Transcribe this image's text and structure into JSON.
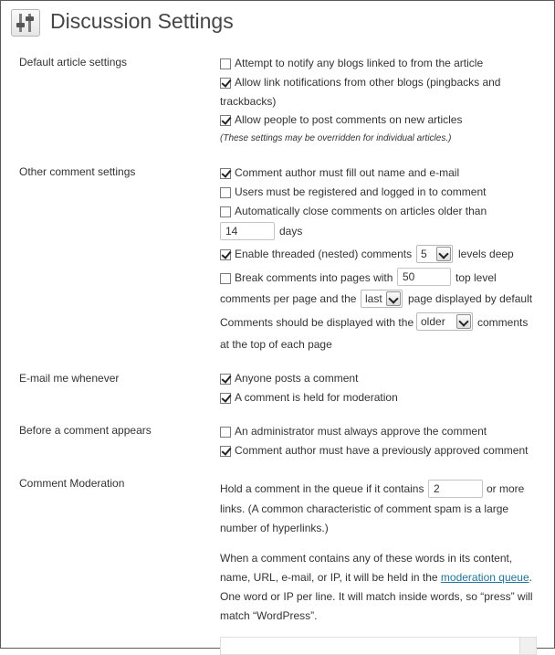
{
  "page": {
    "title": "Discussion Settings",
    "icon": "settings-sliders-icon"
  },
  "default_article": {
    "label": "Default article settings",
    "notify_blogs": {
      "label": "Attempt to notify any blogs linked to from the article",
      "checked": false
    },
    "allow_pingbacks": {
      "label_line1": "Allow link notifications from other blogs (pingbacks and",
      "label_line2": "trackbacks)",
      "checked": true
    },
    "allow_comments": {
      "label": "Allow people to post comments on new articles",
      "checked": true
    },
    "note": "(These settings may be overridden for individual articles.)"
  },
  "other_comment": {
    "label": "Other comment settings",
    "require_name_email": {
      "label": "Comment author must fill out name and e-mail",
      "checked": true
    },
    "registered_only": {
      "label": "Users must be registered and logged in to comment",
      "checked": false
    },
    "auto_close": {
      "label": "Automatically close comments on articles older than",
      "checked": false,
      "days_value": "14",
      "days_suffix": "days"
    },
    "threaded": {
      "label": "Enable threaded (nested) comments",
      "checked": true,
      "depth_value": "5",
      "suffix": "levels deep"
    },
    "paging": {
      "label": "Break comments into pages with",
      "checked": false,
      "per_page_value": "50",
      "suffix": "top level",
      "line2_prefix": "comments per page and the",
      "page_value": "last",
      "line2_suffix": "page displayed by default"
    },
    "order": {
      "prefix": "Comments should be displayed with the",
      "value": "older",
      "suffix": "comments",
      "line2": "at the top of each page"
    }
  },
  "email_me": {
    "label": "E-mail me whenever",
    "anyone_posts": {
      "label": "Anyone posts a comment",
      "checked": true
    },
    "held_for_moderation": {
      "label": "A comment is held for moderation",
      "checked": true
    }
  },
  "before_appears": {
    "label": "Before a comment appears",
    "admin_approve": {
      "label": "An administrator must always approve the comment",
      "checked": false
    },
    "previously_approved": {
      "label": "Comment author must have a previously approved comment",
      "checked": true
    }
  },
  "moderation": {
    "label": "Comment Moderation",
    "hold_prefix": "Hold a comment in the queue if it contains",
    "links_value": "2",
    "hold_suffix": "or more",
    "hold_line2": "links. (A common characteristic of comment spam is a large",
    "hold_line3": "number of hyperlinks.)",
    "words_line1": "When a comment contains any of these words in its content,",
    "words_line2_prefix": "name, URL, e-mail, or IP, it will be held in the",
    "queue_link": "moderation queue",
    "words_line2_suffix": ".",
    "words_line3": "One word or IP per line. It will match inside words, so “press” will",
    "words_line4": "match “WordPress”."
  }
}
